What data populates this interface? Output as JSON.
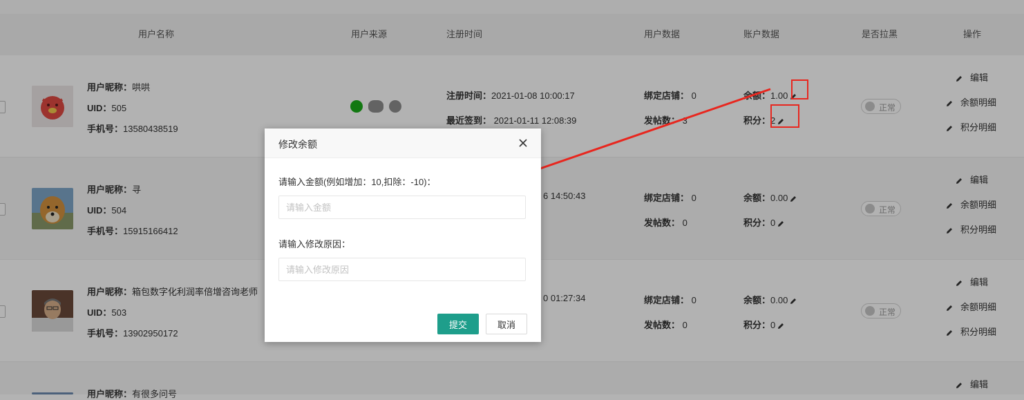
{
  "columns": {
    "name": "用户名称",
    "source": "用户来源",
    "reg_time": "注册时间",
    "user_data": "用户数据",
    "account_data": "账户数据",
    "blacklist": "是否拉黑",
    "actions": "操作"
  },
  "labels": {
    "nickname": "用户昵称：",
    "uid": "UID：",
    "phone": "手机号：",
    "reg_time": "注册时间：",
    "last_sign": "最近签到：",
    "bound_shops": "绑定店铺：",
    "posts": "发帖数：",
    "balance": "余额：",
    "points": "积分："
  },
  "actions": {
    "edit": "编辑",
    "balance_detail": "余额明细",
    "points_detail": "积分明细"
  },
  "status_normal": "正常",
  "users": [
    {
      "nickname": "哄哄",
      "uid": "505",
      "phone": "13580438519",
      "reg_time": "2021-01-08 10:00:17",
      "last_sign": "2021-01-11 12:08:39",
      "bound_shops": "0",
      "posts": "3",
      "balance": "1.00",
      "points": "2"
    },
    {
      "nickname": "寻",
      "uid": "504",
      "phone": "15915166412",
      "reg_time_partial": "6 14:50:43",
      "bound_shops": "0",
      "posts": "0",
      "balance": "0.00",
      "points": "0"
    },
    {
      "nickname": "箱包数字化利润率倍增咨询老师",
      "uid": "503",
      "phone": "13902950172",
      "reg_time_partial": "0 01:27:34",
      "bound_shops": "0",
      "posts": "0",
      "balance": "0.00",
      "points": "0"
    },
    {
      "nickname": "有很多问号"
    }
  ],
  "dialog": {
    "title": "修改余额",
    "amount_label": "请输入金额(例如增加：10,扣除：-10)：",
    "amount_placeholder": "请输入金额",
    "reason_label": "请输入修改原因：",
    "reason_placeholder": "请输入修改原因",
    "submit": "提交",
    "cancel": "取消"
  },
  "colors": {
    "primary": "#1e9e8b",
    "highlight": "#e8261e"
  }
}
